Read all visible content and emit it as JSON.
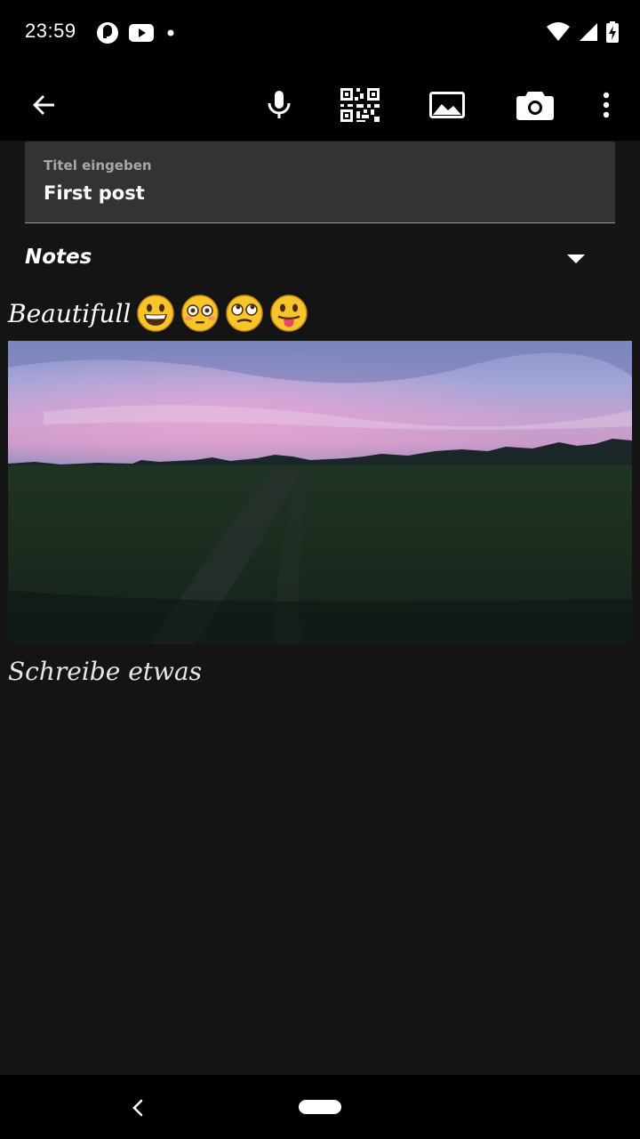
{
  "status_bar": {
    "time": "23:59",
    "left_icons": [
      "pocket-casts-icon",
      "youtube-icon",
      "notification-dot-icon"
    ],
    "right_icons": [
      "wifi-icon",
      "cell-signal-icon",
      "battery-charging-icon"
    ]
  },
  "app_bar": {
    "actions": [
      "back-arrow-icon",
      "microphone-icon",
      "qr-code-icon",
      "image-icon",
      "camera-icon",
      "more-vert-icon"
    ]
  },
  "title_field": {
    "label": "Titel eingeben",
    "value": "First post"
  },
  "category": {
    "selected": "Notes"
  },
  "note": {
    "text": "Beautifull",
    "emojis": [
      "grinning-face-icon",
      "flushed-face-icon",
      "eye-roll-face-icon",
      "tongue-face-icon"
    ],
    "placeholder": "Schreibe etwas"
  },
  "colors": {
    "background": "#141414",
    "input_background": "#333333",
    "bars": "#000000"
  }
}
